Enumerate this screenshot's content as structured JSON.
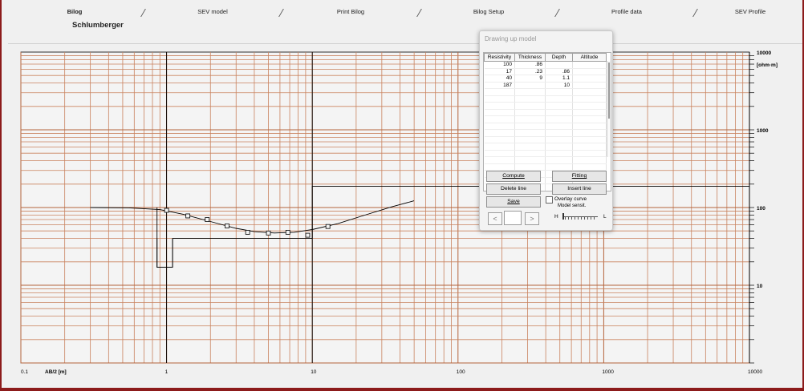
{
  "tabs": [
    {
      "label": "Bilog",
      "active": true
    },
    {
      "label": "SEV model",
      "active": false
    },
    {
      "label": "Print Bilog",
      "active": false
    },
    {
      "label": "Bilog Setup",
      "active": false
    },
    {
      "label": "Profile data",
      "active": false
    },
    {
      "label": "SEV Profile",
      "active": false
    }
  ],
  "subtitle": "Schlumberger",
  "chart_data": {
    "type": "line",
    "x_scale": "log",
    "y_scale": "log",
    "xlim": [
      0.1,
      10000
    ],
    "ylim": [
      1,
      10000
    ],
    "xlabel": "AB/2 [m]",
    "ylabel": "[ohm·m]",
    "x_ticks": [
      "0.1",
      "1",
      "10",
      "100",
      "1000",
      "10000"
    ],
    "y_ticks": [
      "10000",
      "1000",
      "100",
      "10"
    ],
    "measured": {
      "x": [
        1.0,
        1.4,
        1.9,
        2.6,
        3.6,
        5.0,
        6.8,
        9.3,
        12.8
      ],
      "y": [
        92,
        78,
        70,
        58,
        48,
        47,
        48,
        44,
        57
      ]
    },
    "curve": {
      "x": [
        0.3,
        0.55,
        0.9,
        1.3,
        2.0,
        3.0,
        4.0,
        5.5,
        7.5,
        10,
        15,
        22,
        35,
        50
      ],
      "y": [
        100,
        99,
        94,
        82,
        66,
        54,
        49,
        47,
        48,
        52,
        62,
        78,
        102,
        122
      ]
    },
    "model_profile": {
      "x": [
        0.86,
        0.86,
        1.1,
        1.1,
        10,
        10,
        10000
      ],
      "y": [
        100,
        17,
        17,
        40,
        40,
        187,
        187
      ]
    },
    "colors": {
      "grid_major": "#b4643c",
      "grid_minor": "#c9825e",
      "curve": "#000000",
      "background": "#f0f0f0"
    }
  },
  "dialog": {
    "title": "Drawing up model",
    "columns": [
      "Resistivity",
      "Thickness",
      "Depth",
      "Altitude"
    ],
    "rows": [
      {
        "resistivity": "100",
        "thickness": ".86",
        "depth": "",
        "altitude": ""
      },
      {
        "resistivity": "17",
        "thickness": ".23",
        "depth": ".86",
        "altitude": ""
      },
      {
        "resistivity": "40",
        "thickness": "9",
        "depth": "1.1",
        "altitude": ""
      },
      {
        "resistivity": "187",
        "thickness": "",
        "depth": "10",
        "altitude": ""
      }
    ],
    "buttons": {
      "compute": "Compute",
      "fitting": "Fitting",
      "delete_line": "Delete line",
      "insert_line": "Insert line",
      "save": "Save"
    },
    "overlay_label": "Overlay curve",
    "sensitivity_label": "Model sensit.",
    "slider_h": "H",
    "slider_l": "L",
    "spin_left": "<",
    "spin_right": ">"
  }
}
